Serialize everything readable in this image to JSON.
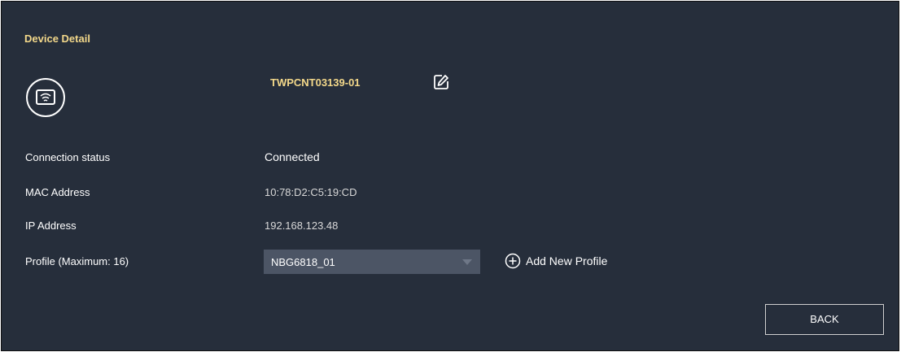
{
  "title": "Device Detail",
  "device": {
    "name": "TWPCNT03139-01",
    "icon": "wireless-device-icon"
  },
  "details": {
    "connection_status_label": "Connection status",
    "connection_status_value": "Connected",
    "mac_label": "MAC Address",
    "mac_value": "10:78:D2:C5:19:CD",
    "ip_label": "IP Address",
    "ip_value": "192.168.123.48",
    "profile_label": "Profile (Maximum: 16)",
    "profile_selected": "NBG6818_01"
  },
  "actions": {
    "add_profile_label": "Add New Profile",
    "back_label": "BACK"
  },
  "colors": {
    "background": "#262e3b",
    "accent": "#f3d88a",
    "select_bg": "#4c5565"
  }
}
